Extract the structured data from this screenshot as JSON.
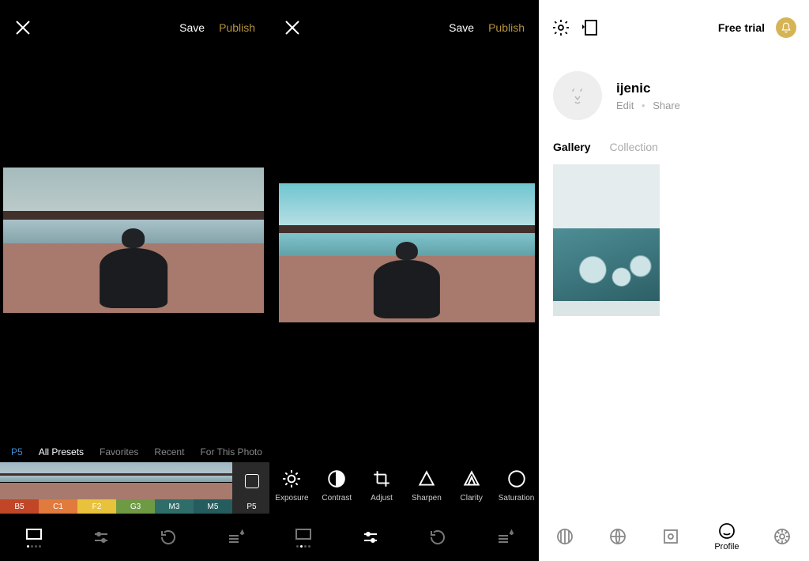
{
  "topbar": {
    "save": "Save",
    "publish": "Publish"
  },
  "pane1": {
    "selected_preset": "P5",
    "tabs": {
      "all": "All Presets",
      "favorites": "Favorites",
      "recent": "Recent",
      "for_this": "For This Photo"
    },
    "presets": [
      {
        "code": "B5",
        "color": "#c14628"
      },
      {
        "code": "C1",
        "color": "#e07a3d"
      },
      {
        "code": "F2",
        "color": "#e8c23a"
      },
      {
        "code": "G3",
        "color": "#6f9a44"
      },
      {
        "code": "M3",
        "color": "#2f6d6a"
      },
      {
        "code": "M5",
        "color": "#255c5e"
      },
      {
        "code": "P5",
        "color": "#2a2a2a"
      }
    ],
    "nav_active_dot": 0
  },
  "pane2": {
    "tools": [
      {
        "key": "exposure",
        "label": "Exposure"
      },
      {
        "key": "contrast",
        "label": "Contrast"
      },
      {
        "key": "adjust",
        "label": "Adjust"
      },
      {
        "key": "sharpen",
        "label": "Sharpen"
      },
      {
        "key": "clarity",
        "label": "Clarity"
      },
      {
        "key": "saturation",
        "label": "Saturation"
      }
    ],
    "nav_active_dot": 1
  },
  "pane3": {
    "free_trial": "Free trial",
    "username": "ijenic",
    "edit": "Edit",
    "share": "Share",
    "tabs": {
      "gallery": "Gallery",
      "collection": "Collection"
    },
    "active_tab": "gallery",
    "nav": {
      "profile": "Profile"
    }
  }
}
